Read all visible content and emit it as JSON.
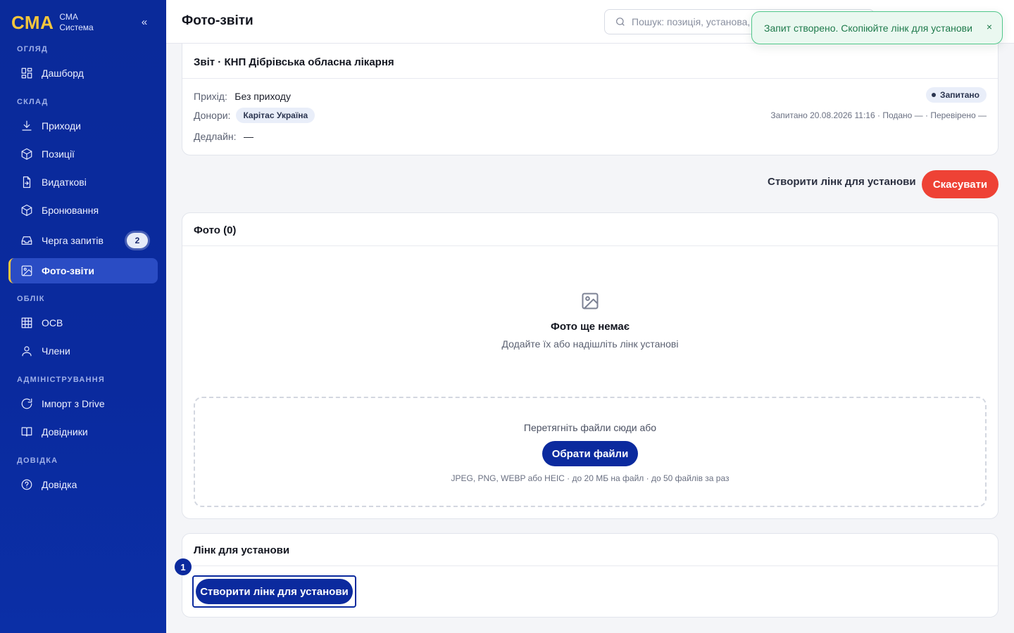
{
  "brand": {
    "logo": "СМА",
    "line1": "СМА",
    "line2": "Система",
    "collapse": "«",
    "accent": "#f5c63c"
  },
  "sidebar": {
    "sections": [
      {
        "title": "ОГЛЯД"
      },
      {
        "title": "СКЛАД"
      },
      {
        "title": "ОБЛІК"
      },
      {
        "title": "АДМІНІСТРУВАННЯ"
      },
      {
        "title": "ДОВІДКА"
      }
    ],
    "items": [
      {
        "label": "Дашборд",
        "icon": "dashboard-icon"
      },
      {
        "label": "Приходи",
        "icon": "download-icon"
      },
      {
        "label": "Позиції",
        "icon": "box-icon"
      },
      {
        "label": "Видаткові",
        "icon": "file-out-icon"
      },
      {
        "label": "Бронювання",
        "icon": "box-icon"
      },
      {
        "label": "Черга запитів",
        "icon": "inbox-icon",
        "badge": "2"
      },
      {
        "label": "Фото-звіти",
        "icon": "image-icon",
        "active": true
      },
      {
        "label": "ОСВ",
        "icon": "table-icon"
      },
      {
        "label": "Члени",
        "icon": "user-icon"
      },
      {
        "label": "Імпорт з Drive",
        "icon": "refresh-icon"
      },
      {
        "label": "Довідники",
        "icon": "book-icon"
      },
      {
        "label": "Довідка",
        "icon": "help-icon"
      }
    ]
  },
  "header": {
    "title": "Фото-звіти",
    "search_placeholder": "Пошук: позиція, установа, донор..."
  },
  "toast": {
    "text": "Запит створено. Скопіюйте лінк для установи",
    "close": "×",
    "color": "#1e7a4b"
  },
  "report": {
    "title": "Звіт · КНП Дібрівська обласна лікарня",
    "arrival_label": "Прихід:",
    "arrival_value": "Без приходу",
    "donors_label": "Донори:",
    "donor_tag": "Карітас Україна",
    "deadline_label": "Дедлайн:",
    "deadline_value": "—",
    "status": "Запитано",
    "meta": "Запитано 20.08.2026 11:16 · Подано — · Перевірено —"
  },
  "actions": {
    "create_link": "Створити лінк для установи",
    "cancel": "Скасувати",
    "cancel_color": "#ee4235"
  },
  "photos": {
    "title": "Фото (0)",
    "empty_title": "Фото ще немає",
    "empty_subtitle": "Додайте їх або надішліть лінк установі",
    "drop_text": "Перетягніть файли сюди або",
    "choose_files": "Обрати файли",
    "hint": "JPEG, PNG, WEBP або HEIC · до 20 МБ на файл · до 50 файлів за раз"
  },
  "link_section": {
    "title": "Лінк для установи",
    "button": "Створити лінк для установи",
    "step": "1",
    "primary_color": "#0b2a9e"
  }
}
